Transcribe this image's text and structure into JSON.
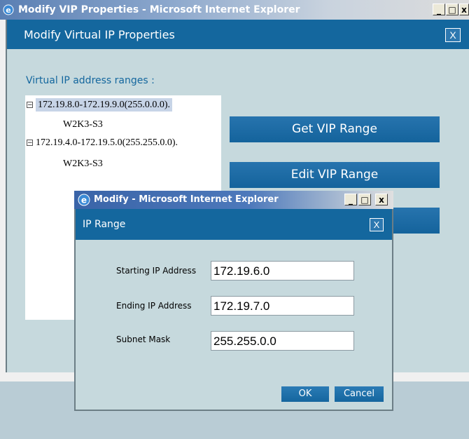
{
  "outer_window": {
    "title": "Modify VIP Properties - Microsoft Internet Explorer",
    "minimize": "_",
    "maximize": "□",
    "close": "x"
  },
  "main_dialog": {
    "title": "Modify Virtual IP Properties",
    "close_label": "X",
    "section_label": "Virtual IP address ranges :",
    "tree": [
      {
        "label": "172.19.8.0-172.19.9.0(255.0.0.0).",
        "expander": "−",
        "child": "W2K3-S3",
        "selected": true
      },
      {
        "label": "172.19.4.0-172.19.5.0(255.255.0.0).",
        "expander": "−",
        "child": "W2K3-S3",
        "selected": false
      }
    ],
    "buttons": {
      "get_vip_range": "Get VIP Range",
      "edit_vip_range": "Edit VIP Range",
      "third": ""
    }
  },
  "popup_window": {
    "title": "Modify - Microsoft Internet Explorer",
    "minimize": "_",
    "maximize": "□",
    "close": "x"
  },
  "popup_dialog": {
    "title": "IP Range",
    "close_label": "X",
    "fields": {
      "starting_label": "Starting IP Address",
      "starting_value": "172.19.6.0",
      "ending_label": "Ending IP Address",
      "ending_value": "172.19.7.0",
      "mask_label": "Subnet Mask",
      "mask_value": "255.255.0.0"
    },
    "ok": "OK",
    "cancel": "Cancel"
  },
  "colors": {
    "header_blue": "#14679e",
    "dialog_bg": "#c6d9dd",
    "selection": "#c7d4e7"
  }
}
